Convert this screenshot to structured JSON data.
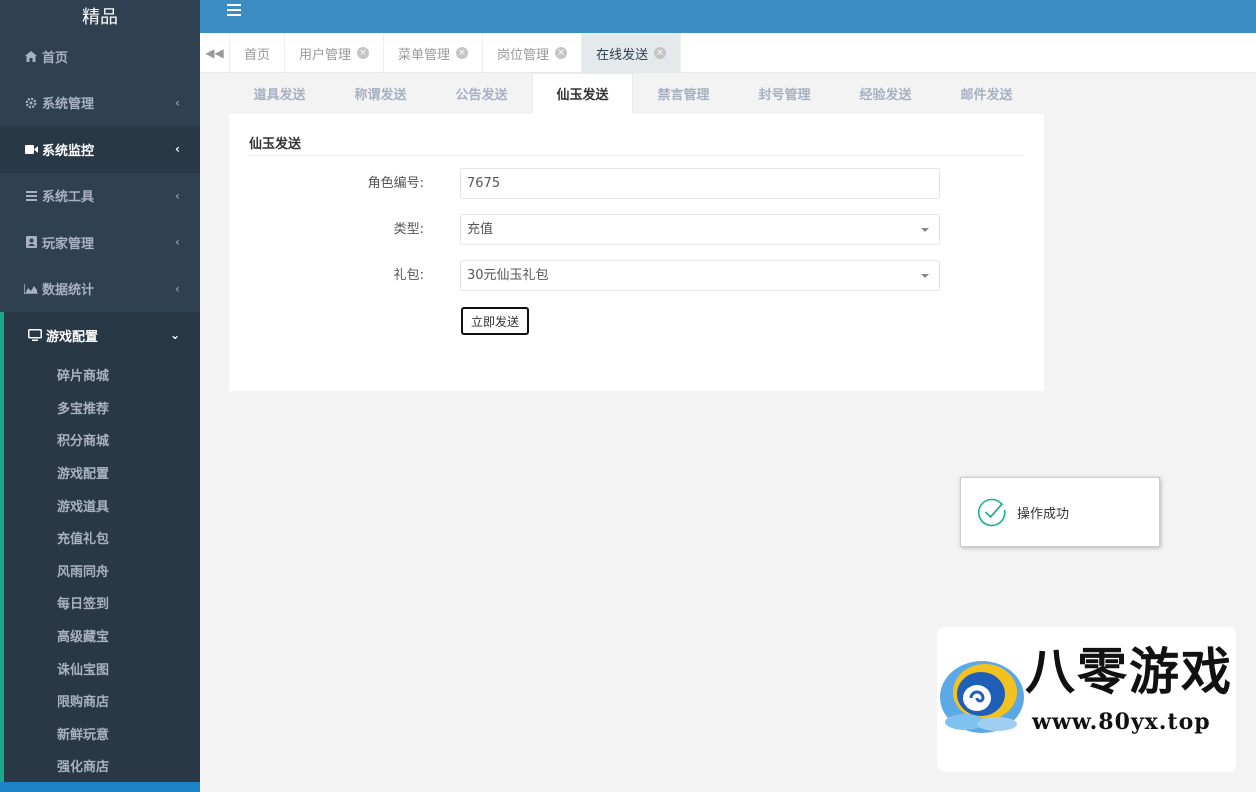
{
  "app": {
    "logo_text": "精品"
  },
  "sidebar": {
    "items": [
      {
        "label": "首页",
        "icon": "home-icon"
      },
      {
        "label": "系统管理",
        "icon": "gear-icon"
      },
      {
        "label": "系统监控",
        "icon": "video-camera-icon"
      },
      {
        "label": "系统工具",
        "icon": "bars-icon"
      },
      {
        "label": "玩家管理",
        "icon": "user-card-icon"
      },
      {
        "label": "数据统计",
        "icon": "area-chart-icon"
      },
      {
        "label": "游戏配置",
        "icon": "desktop-icon"
      }
    ],
    "submenu": [
      "碎片商城",
      "多宝推荐",
      "积分商城",
      "游戏配置",
      "游戏道具",
      "充值礼包",
      "风雨同舟",
      "每日签到",
      "高级藏宝",
      "诛仙宝图",
      "限购商店",
      "新鲜玩意",
      "强化商店"
    ]
  },
  "tabs": [
    {
      "label": "首页"
    },
    {
      "label": "用户管理"
    },
    {
      "label": "菜单管理"
    },
    {
      "label": "岗位管理"
    },
    {
      "label": "在线发送"
    }
  ],
  "subtabs": [
    "道具发送",
    "称谓发送",
    "公告发送",
    "仙玉发送",
    "禁言管理",
    "封号管理",
    "经验发送",
    "邮件发送"
  ],
  "form": {
    "title": "仙玉发送",
    "role_id_label": "角色编号:",
    "role_id_value": "7675",
    "type_label": "类型:",
    "type_value": "充值",
    "gift_label": "礼包:",
    "gift_value": "30元仙玉礼包",
    "submit_label": "立即发送"
  },
  "toast": {
    "message": "操作成功",
    "icon": "check-circle-icon",
    "color": "#1ab394"
  },
  "watermark": {
    "brand": "八零游戏",
    "url": "www.80yx.top"
  },
  "colors": {
    "sidebar": "#2f4050",
    "topbar": "#3b8dc4",
    "accent": "#19aa8d"
  }
}
